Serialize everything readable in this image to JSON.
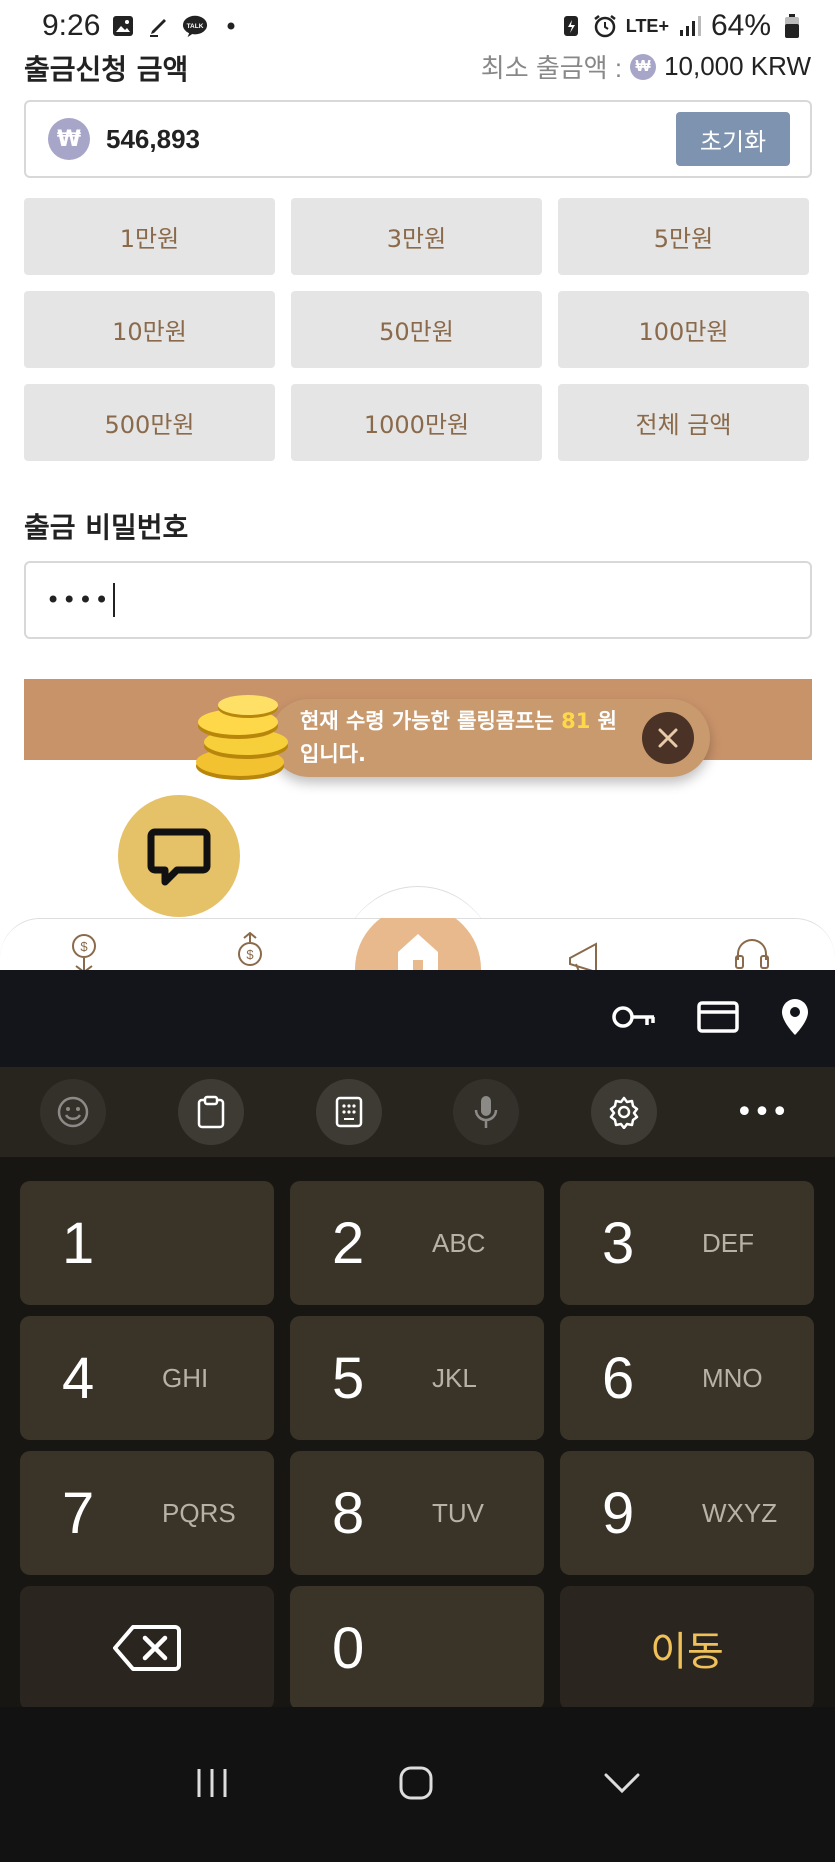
{
  "status_bar": {
    "time": "9:26",
    "network": "LTE+",
    "battery": "64%"
  },
  "withdraw_amount": {
    "title": "출금신청 금액",
    "min_label": "최소 출금액 :",
    "min_currency_symbol": "₩",
    "min_value": "10,000 KRW",
    "currency_symbol": "₩",
    "amount_value": "546,893",
    "reset_label": "초기화"
  },
  "quick_amounts": [
    "1만원",
    "3만원",
    "5만원",
    "10만원",
    "50만원",
    "100만원",
    "500만원",
    "1000만원",
    "전체 금액"
  ],
  "password": {
    "title": "출금 비밀번호",
    "value": "••••"
  },
  "toast": {
    "text_before": "현재 수령 가능한 롤링콤프는",
    "amount": "81",
    "text_after": "원 입니다."
  },
  "keyboard": {
    "keys": [
      {
        "num": "1",
        "sub": ""
      },
      {
        "num": "2",
        "sub": "ABC"
      },
      {
        "num": "3",
        "sub": "DEF"
      },
      {
        "num": "4",
        "sub": "GHI"
      },
      {
        "num": "5",
        "sub": "JKL"
      },
      {
        "num": "6",
        "sub": "MNO"
      },
      {
        "num": "7",
        "sub": "PQRS"
      },
      {
        "num": "8",
        "sub": "TUV"
      },
      {
        "num": "9",
        "sub": "WXYZ"
      },
      {
        "num": "0",
        "sub": ""
      }
    ],
    "go_label": "이동",
    "more_label": "•••"
  },
  "colors": {
    "accent_brown": "#8a6a4a",
    "reset_button": "#7d93b0",
    "banner": "#c9936a",
    "highlight": "#ffd84a",
    "chat_fab": "#e5c168",
    "go_key": "#f0c15a"
  }
}
